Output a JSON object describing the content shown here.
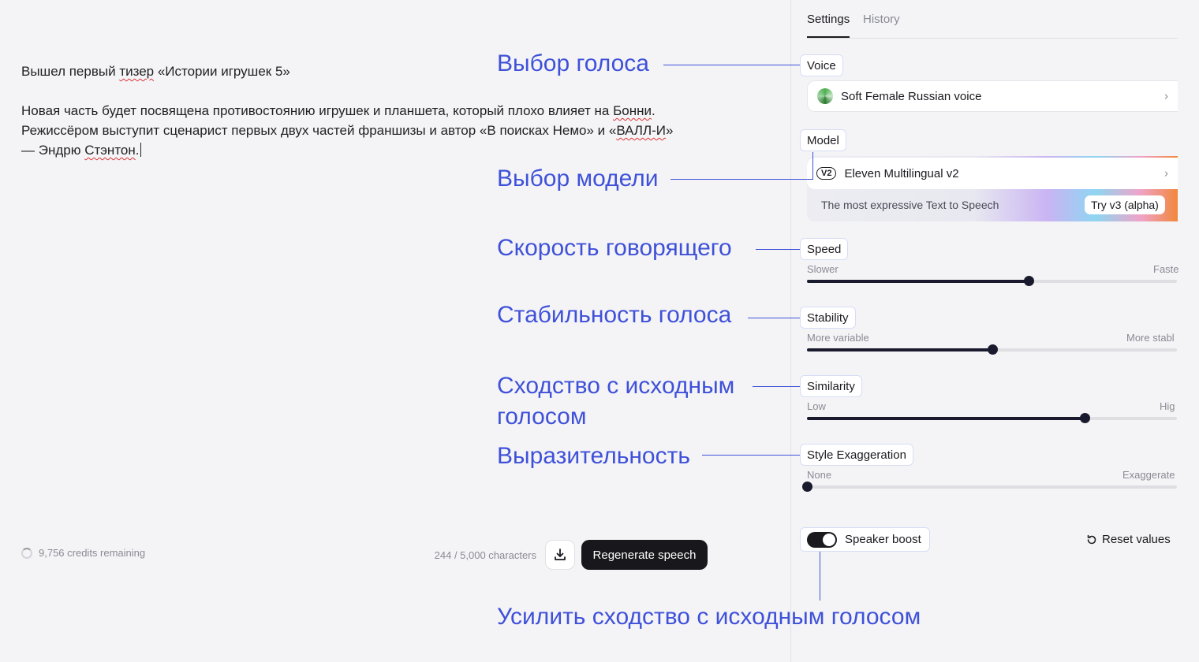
{
  "editor": {
    "line1": "Вышел первый ",
    "line1_spell": "тизер",
    "line1_rest": " «Истории игрушек 5»",
    "p2_a": "Новая часть будет посвящена противостоянию игрушек и планшета, который плохо влияет на ",
    "p2_b_spell": "Бонни",
    "p2_c": ".",
    "p3_a": "Режиссёром выступит сценарист первых двух частей франшизы и автор «В поисках Немо» и «",
    "p3_b_spell": "ВАЛЛ-И",
    "p3_c": "»",
    "p4_a": "— Эндрю ",
    "p4_b_spell": "Стэнтон",
    "p4_c": "."
  },
  "footer": {
    "credits": "9,756 credits remaining",
    "char_count": "244 / 5,000 characters",
    "regenerate_label": "Regenerate speech",
    "download_icon": "download-icon"
  },
  "tabs": {
    "settings": "Settings",
    "history": "History"
  },
  "settings": {
    "voice_label": "Voice",
    "voice_name": "Soft Female Russian voice",
    "model_label": "Model",
    "model_badge": "V2",
    "model_name": "Eleven Multilingual v2",
    "model_promo": "The most expressive Text to Speech",
    "model_try": "Try v3 (alpha)",
    "speed": {
      "label": "Speed",
      "min": "Slower",
      "max": "Faste",
      "value": 0.6
    },
    "stability": {
      "label": "Stability",
      "min": "More variable",
      "max": "More stabl",
      "value": 0.5
    },
    "similarity": {
      "label": "Similarity",
      "min": "Low",
      "max": "Hig",
      "value": 0.75
    },
    "style": {
      "label": "Style Exaggeration",
      "min": "None",
      "max": "Exaggerate",
      "value": 0.0
    },
    "speaker_boost": {
      "label": "Speaker boost",
      "enabled": true
    },
    "reset_label": "Reset values"
  },
  "annotations": {
    "voice": "Выбор голоса",
    "model": "Выбор модели",
    "speed": "Скорость говорящего",
    "stability": "Стабильность голоса",
    "similarity_1": "Сходство с исходным",
    "similarity_2": "голосом",
    "style": "Выразительность",
    "boost": "Усилить сходство с исходным голосом"
  },
  "colors": {
    "annotation": "#3f51d8",
    "primary_button": "#17171c",
    "slider": "#1a1a2e"
  }
}
